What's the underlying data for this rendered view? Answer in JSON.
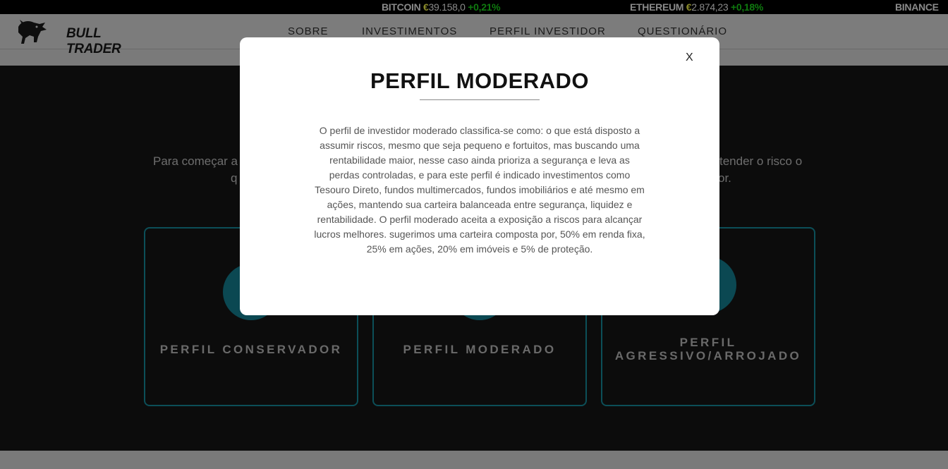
{
  "ticker": [
    {
      "name": "BITCOIN",
      "currency": "€",
      "price": "39.158,0",
      "change": "+0,21%"
    },
    {
      "name": "ETHEREUM",
      "currency": "€",
      "price": "2.874,23",
      "change": "+0,18%"
    },
    {
      "name": "BINANCE"
    }
  ],
  "brand": {
    "name": "BULL TRADER"
  },
  "nav": [
    "SOBRE",
    "INVESTIMENTOS",
    "PERFIL INVESTIDOR",
    "QUESTIONÁRIO"
  ],
  "intro": {
    "line1_start": "Para começar a",
    "line1_end": "tender o risco o",
    "line2_start": "q",
    "line2_end": "or."
  },
  "cards": [
    {
      "label": "PERFIL CONSERVADOR"
    },
    {
      "label": "PERFIL MODERADO"
    },
    {
      "label_line1": "PERFIL",
      "label_line2": "AGRESSIVO/ARROJADO"
    }
  ],
  "modal": {
    "close": "X",
    "title": "PERFIL MODERADO",
    "body": "O perfil de investidor moderado classifica-se como: o que está disposto a assumir riscos, mesmo que seja pequeno e fortuitos, mas buscando uma rentabilidade maior, nesse caso ainda prioriza a segurança e leva as perdas controladas, e para este perfil é indicado investimentos como Tesouro Direto, fundos multimercados, fundos imobiliários e até mesmo em ações, mantendo sua carteira balanceada entre segurança, liquidez e rentabilidade. O perfil moderado aceita a exposição a riscos para alcançar lucros melhores. sugerimos uma carteira composta por, 50% em renda fixa, 25% em ações, 20% em imóveis e 5% de proteção."
  },
  "colors": {
    "accent": "#1ab3c4",
    "price_up": "#28d328",
    "euro": "#e0e01a",
    "modal_bg": "#ffffff"
  }
}
